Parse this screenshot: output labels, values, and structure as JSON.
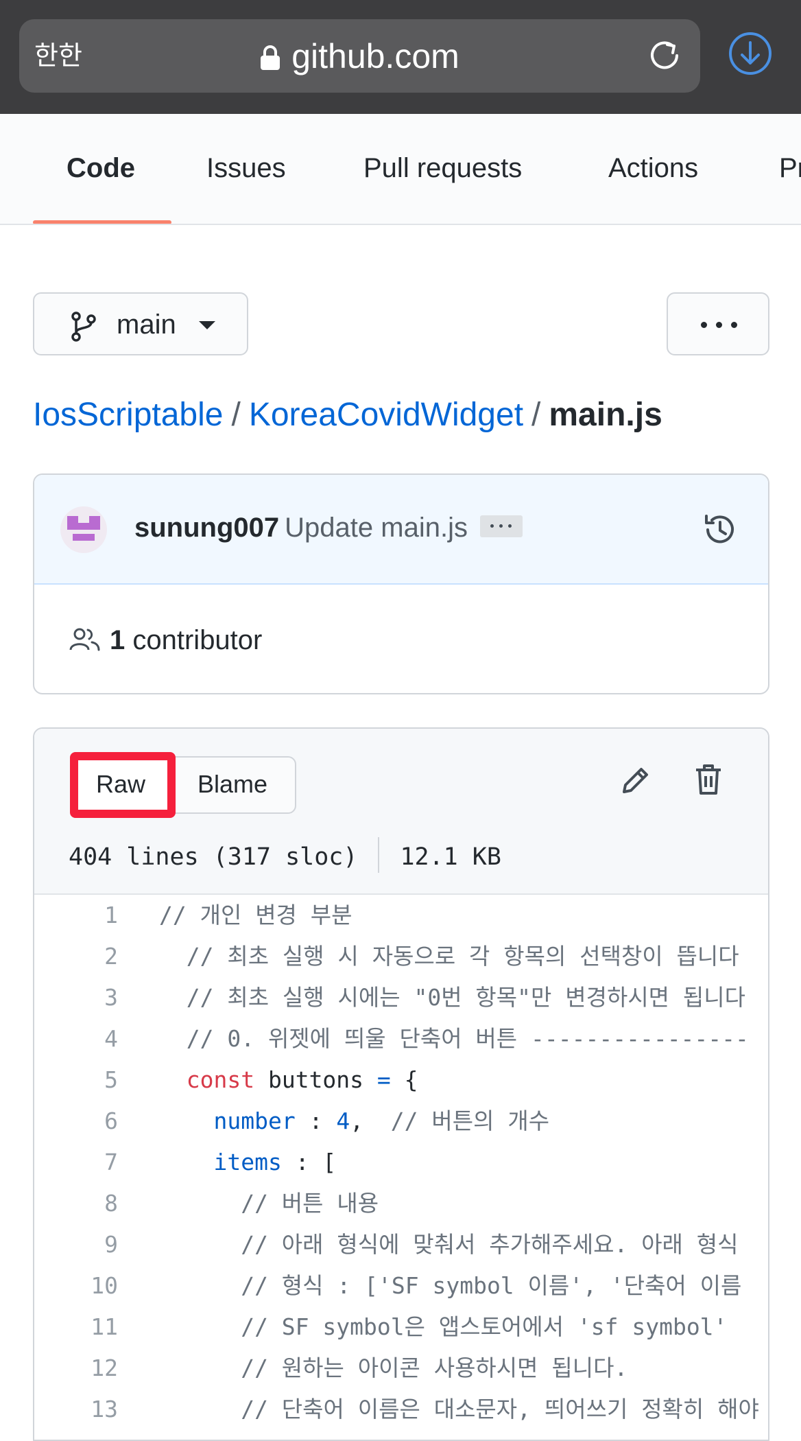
{
  "browser": {
    "text_size_button": "한한",
    "url": "github.com",
    "accent_color": "#4a90e2"
  },
  "nav": {
    "tabs": [
      {
        "label": "Code",
        "active": true
      },
      {
        "label": "Issues",
        "active": false
      },
      {
        "label": "Pull requests",
        "active": false
      },
      {
        "label": "Actions",
        "active": false
      },
      {
        "label": "Pr",
        "active": false
      }
    ],
    "active_underline_color": "#f9826c"
  },
  "branch": {
    "name": "main"
  },
  "breadcrumb": {
    "repo": "IosScriptable",
    "folder": "KoreaCovidWidget",
    "file": "main.js",
    "separator": "/"
  },
  "commit": {
    "author": "sunung007",
    "message": "Update main.js",
    "contributors_count": "1",
    "contributors_label": "contributor"
  },
  "file": {
    "raw_label": "Raw",
    "blame_label": "Blame",
    "lines_info": "404 lines (317 sloc)",
    "size": "12.1 KB",
    "highlight_color": "#f5203c"
  },
  "code": {
    "lines": [
      {
        "n": "1",
        "tokens": [
          {
            "t": "// 개인 변경 부분",
            "c": "cm"
          }
        ]
      },
      {
        "n": "2",
        "tokens": [
          {
            "t": "  // 최초 실행 시 자동으로 각 항목의 선택창이 뜹니다",
            "c": "cm"
          }
        ]
      },
      {
        "n": "3",
        "tokens": [
          {
            "t": "  // 최초 실행 시에는 \"0번 항목\"만 변경하시면 됩니다",
            "c": "cm"
          }
        ]
      },
      {
        "n": "4",
        "tokens": [
          {
            "t": "  // 0. 위젯에 띄울 단축어 버튼 ----------------",
            "c": "cm"
          }
        ]
      },
      {
        "n": "5",
        "tokens": [
          {
            "t": "  ",
            "c": ""
          },
          {
            "t": "const",
            "c": "kw"
          },
          {
            "t": " buttons ",
            "c": ""
          },
          {
            "t": "=",
            "c": "pr"
          },
          {
            "t": " {",
            "c": ""
          }
        ]
      },
      {
        "n": "6",
        "tokens": [
          {
            "t": "    ",
            "c": ""
          },
          {
            "t": "number",
            "c": "pr"
          },
          {
            "t": " : ",
            "c": ""
          },
          {
            "t": "4",
            "c": "pr"
          },
          {
            "t": ",  ",
            "c": ""
          },
          {
            "t": "// 버튼의 개수",
            "c": "cm"
          }
        ]
      },
      {
        "n": "7",
        "tokens": [
          {
            "t": "    ",
            "c": ""
          },
          {
            "t": "items",
            "c": "pr"
          },
          {
            "t": " : [",
            "c": ""
          }
        ]
      },
      {
        "n": "8",
        "tokens": [
          {
            "t": "      // 버튼 내용",
            "c": "cm"
          }
        ]
      },
      {
        "n": "9",
        "tokens": [
          {
            "t": "      // 아래 형식에 맞춰서 추가해주세요. 아래 형식",
            "c": "cm"
          }
        ]
      },
      {
        "n": "10",
        "tokens": [
          {
            "t": "      // 형식 : ['SF symbol 이름', '단축어 이름",
            "c": "cm"
          }
        ]
      },
      {
        "n": "11",
        "tokens": [
          {
            "t": "      // SF symbol은 앱스토어에서 'sf symbol'",
            "c": "cm"
          }
        ]
      },
      {
        "n": "12",
        "tokens": [
          {
            "t": "      // 원하는 아이콘 사용하시면 됩니다.",
            "c": "cm"
          }
        ]
      },
      {
        "n": "13",
        "tokens": [
          {
            "t": "      // 단축어 이름은 대소문자, 띄어쓰기 정확히 해야",
            "c": "cm"
          }
        ]
      }
    ]
  }
}
